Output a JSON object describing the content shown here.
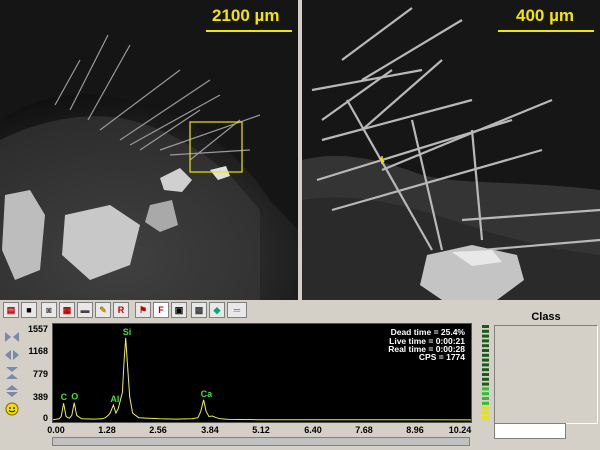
{
  "images": {
    "left": {
      "scale_label": "2100 µm"
    },
    "right": {
      "scale_label": "400 µm"
    }
  },
  "toolbar": {
    "icons": [
      "open-folder-icon",
      "save-icon",
      "camera-icon",
      "print-preview-icon",
      "printer-icon",
      "export-icon",
      "report-icon",
      "flag-icon",
      "f-icon",
      "stop-icon",
      "grid-icon",
      "palette-icon",
      "ruler-icon"
    ]
  },
  "spectrum": {
    "y_ticks": [
      "1557",
      "1168",
      "779",
      "389",
      "0"
    ],
    "x_ticks": [
      "0.00",
      "1.28",
      "2.56",
      "3.84",
      "5.12",
      "6.40",
      "7.68",
      "8.96",
      "10.24"
    ],
    "stats": {
      "dead_time": "Dead time = 25.4%",
      "live_time": "Live time = 0:00:21",
      "real_time": "Real time = 0:00:28",
      "cps": "CPS = 1774"
    },
    "element_labels": [
      "C",
      "O",
      "Al",
      "Si",
      "Ca"
    ]
  },
  "chart_data": {
    "type": "line",
    "xlabel": "",
    "ylabel": "",
    "xlim": [
      0,
      10.24
    ],
    "ylim": [
      0,
      1557
    ],
    "series": [
      {
        "values": [
          [
            0.0,
            5
          ],
          [
            0.15,
            20
          ],
          [
            0.2,
            60
          ],
          [
            0.26,
            290
          ],
          [
            0.32,
            60
          ],
          [
            0.4,
            30
          ],
          [
            0.46,
            80
          ],
          [
            0.52,
            300
          ],
          [
            0.58,
            80
          ],
          [
            0.7,
            20
          ],
          [
            1.0,
            15
          ],
          [
            1.2,
            20
          ],
          [
            1.28,
            40
          ],
          [
            1.35,
            80
          ],
          [
            1.4,
            120
          ],
          [
            1.48,
            260
          ],
          [
            1.54,
            120
          ],
          [
            1.6,
            200
          ],
          [
            1.7,
            480
          ],
          [
            1.74,
            1000
          ],
          [
            1.78,
            1420
          ],
          [
            1.82,
            1000
          ],
          [
            1.88,
            400
          ],
          [
            1.95,
            120
          ],
          [
            2.1,
            40
          ],
          [
            2.6,
            20
          ],
          [
            3.0,
            15
          ],
          [
            3.4,
            20
          ],
          [
            3.55,
            40
          ],
          [
            3.62,
            150
          ],
          [
            3.69,
            350
          ],
          [
            3.75,
            150
          ],
          [
            3.82,
            60
          ],
          [
            3.9,
            70
          ],
          [
            4.0,
            40
          ],
          [
            4.1,
            20
          ],
          [
            4.3,
            10
          ],
          [
            5.0,
            6
          ],
          [
            6.0,
            5
          ],
          [
            7.0,
            4
          ],
          [
            8.0,
            3
          ],
          [
            9.0,
            3
          ],
          [
            10.24,
            2
          ]
        ]
      }
    ],
    "annotations": [
      {
        "text": "C",
        "x": 0.26,
        "y": 290
      },
      {
        "text": "O",
        "x": 0.52,
        "y": 300
      },
      {
        "text": "Al",
        "x": 1.48,
        "y": 260
      },
      {
        "text": "Si",
        "x": 1.78,
        "y": 1420
      },
      {
        "text": "Ca",
        "x": 3.69,
        "y": 350
      }
    ]
  },
  "class_panel": {
    "title": "Class",
    "input_value": ""
  }
}
